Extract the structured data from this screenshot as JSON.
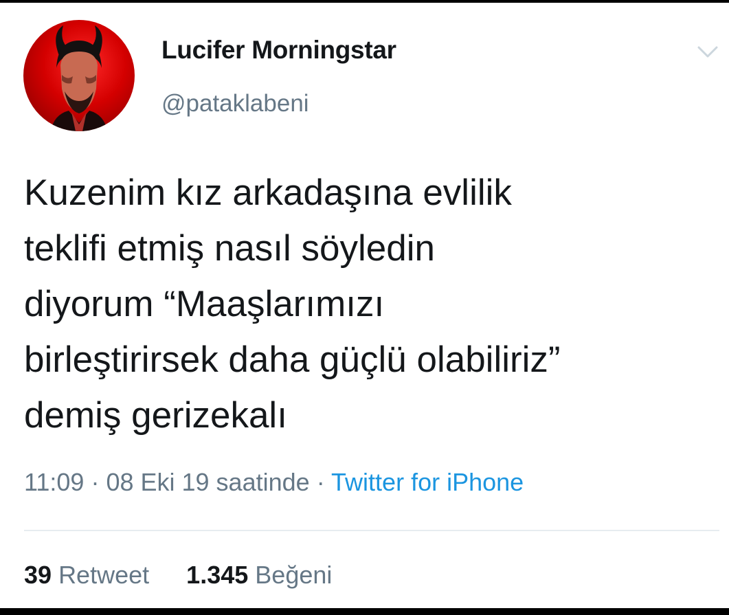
{
  "user": {
    "display_name": "Lucifer Morningstar",
    "handle": "@pataklabeni",
    "avatar_icon": "profile-avatar"
  },
  "tweet": {
    "lines": [
      "Kuzenim kız arkadaşına evlilik",
      "teklifi etmiş nasıl söyledin",
      "diyorum “Maaşlarımızı",
      "birleştirirsek daha güçlü olabiliriz”",
      "demiş gerizekalı"
    ]
  },
  "meta": {
    "time": "11:09",
    "separator": "·",
    "date": "08 Eki 19 saatinde",
    "source": "Twitter for iPhone"
  },
  "stats": {
    "retweet_count": "39",
    "retweet_label": "Retweet",
    "like_count": "1.345",
    "like_label": "Beğeni"
  },
  "colors": {
    "text": "#14171a",
    "secondary": "#657786",
    "link": "#1b95e0",
    "divider": "#e6ecf0"
  }
}
